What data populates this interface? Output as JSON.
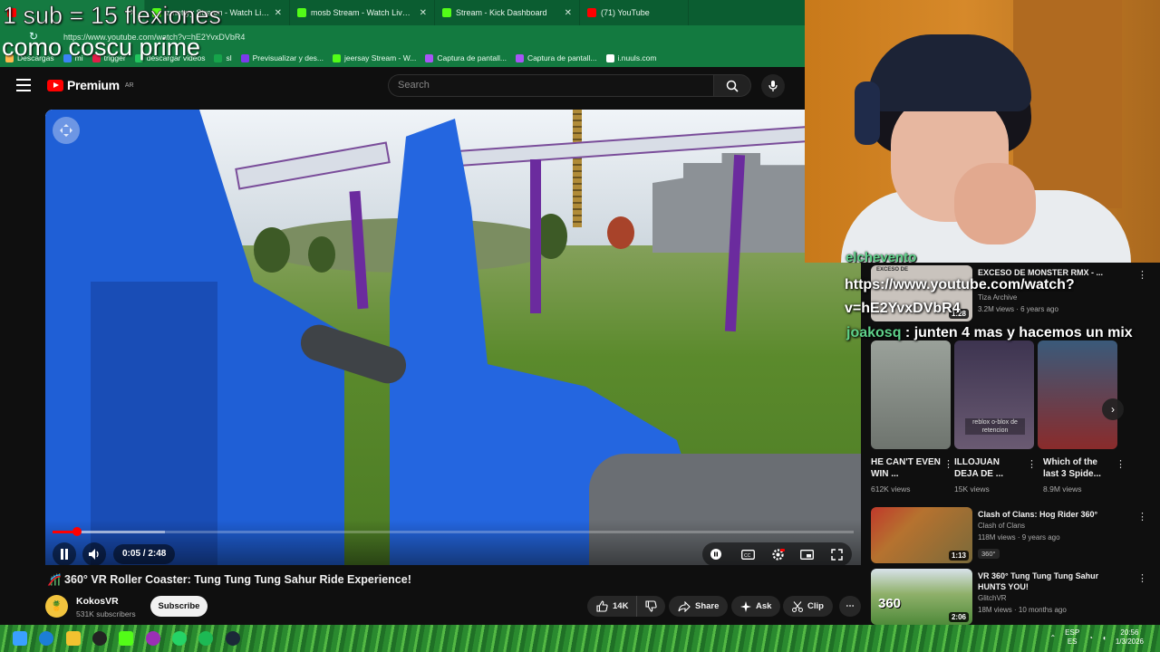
{
  "overlay": {
    "line1": "1 sub = 15 flexiones",
    "line2": "como coscu prime"
  },
  "browser": {
    "tabs": [
      {
        "label": "",
        "favicon_color": "#ff0000",
        "active": true
      },
      {
        "label": "zmattyy Stream - Watch Live on K",
        "favicon_color": "#53fc18",
        "active": false
      },
      {
        "label": "mosb Stream - Watch Live on Kick",
        "favicon_color": "#53fc18",
        "active": false
      },
      {
        "label": "Stream - Kick Dashboard",
        "favicon_color": "#53fc18",
        "active": false
      },
      {
        "label": "(71) YouTube",
        "favicon_color": "#ff0000",
        "active": false
      }
    ],
    "url": "https://www.youtube.com/watch?v=hE2YvxDVbR4",
    "bookmarks": [
      {
        "label": "Descargas",
        "color": "#ffb84d"
      },
      {
        "label": "mi",
        "color": "#3b82f6"
      },
      {
        "label": "trigger",
        "color": "#e11d48"
      },
      {
        "label": "descargar videos",
        "color": "#22c55e"
      },
      {
        "label": "sl",
        "color": "#16a34a"
      },
      {
        "label": "Previsualizar y des...",
        "color": "#7c3aed"
      },
      {
        "label": "jeersay Stream - W...",
        "color": "#53fc18"
      },
      {
        "label": "Captura de pantall...",
        "color": "#a855f7"
      },
      {
        "label": "Captura de pantall...",
        "color": "#a855f7"
      },
      {
        "label": "i.nuuls.com",
        "color": "#ffffff"
      }
    ]
  },
  "youtube": {
    "logo_text": "Premium",
    "logo_country": "AR",
    "search_placeholder": "Search"
  },
  "player": {
    "current_time": "0:05",
    "duration": "2:48",
    "time_display": "0:05 / 2:48",
    "played_fraction": 0.03,
    "buffered_fraction": 0.14
  },
  "video": {
    "title": "🎢 360° VR Roller Coaster: Tung Tung Tung Sahur Ride Experience!",
    "channel_name": "KokosVR",
    "subscribers": "531K subscribers",
    "subscribe_label": "Subscribe",
    "likes": "14K",
    "share_label": "Share",
    "ask_label": "Ask",
    "clip_label": "Clip"
  },
  "chat": {
    "msg1_user": "elchevento",
    "msg1_text": "https://www.youtube.com/watch?v=hE2YvxDVbR4",
    "msg2_user": "joakosq",
    "msg2_text": "junten 4 mas y hacemos un mix"
  },
  "recommendations": [
    {
      "title": "EXCESO DE MONSTER RMX - ...",
      "channel": "Tiza Archive",
      "meta": "3.2M views · 6 years ago",
      "duration": "1:28",
      "thumb_color": "#c9c3bd",
      "thumb_label": "EXCESO DE"
    },
    {
      "title": "Clash of Clans: Hog Rider 360°",
      "channel": "Clash of Clans",
      "meta": "118M views · 9 years ago",
      "duration": "1:13",
      "tag": "360°",
      "thumb_color": "#b6722f"
    },
    {
      "title": "VR 360° Tung Tung Tung Sahur HUNTS YOU!",
      "channel": "GlitchVR",
      "meta": "18M views · 10 months ago",
      "duration": "2:06",
      "thumb_color": "#4f8a3a",
      "thumb_label": "360"
    }
  ],
  "shorts": [
    {
      "title": "HE CAN'T EVEN WIN ...",
      "views": "612K views",
      "color": "#8a8f86"
    },
    {
      "title": "ILLOJUAN DEJA DE ...",
      "views": "15K views",
      "color": "#5a4a6a",
      "overlay_text": "reblox o-blox de retencion"
    },
    {
      "title": "Which of the last 3 Spide...",
      "views": "8.9M views",
      "color": "#7a3a3a"
    }
  ],
  "taskbar": {
    "language_top": "ESP",
    "language_bottom": "ES",
    "time": "20:56",
    "date": "1/3/2026"
  }
}
